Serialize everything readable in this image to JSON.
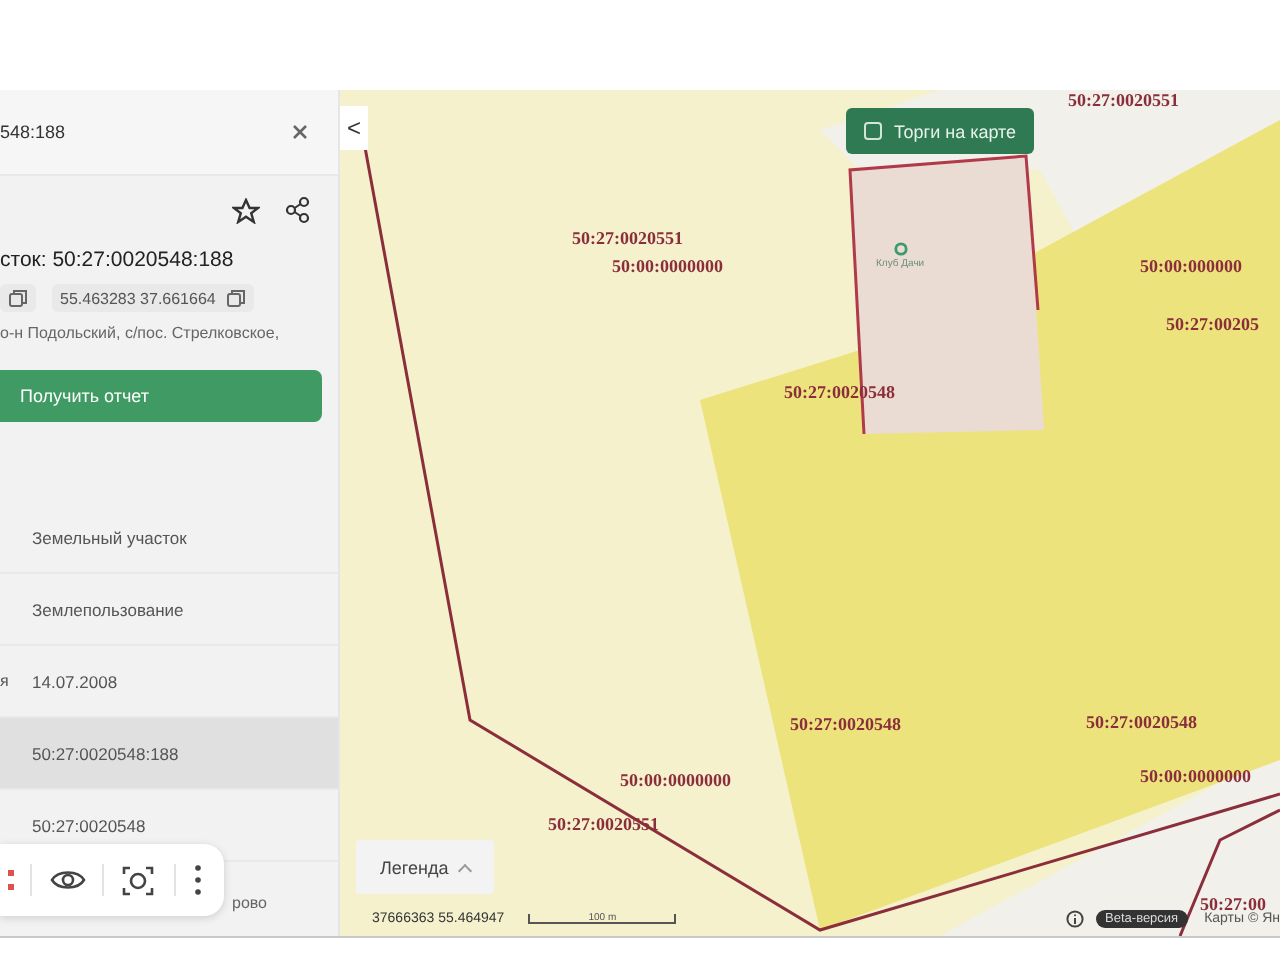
{
  "panel": {
    "title": "548:188",
    "heading": "сток: 50:27:0020548:188",
    "coords": "55.463283 37.661664",
    "address": "о-н Подольский, с/пос. Стрелковское,",
    "report_button": "Получить отчет",
    "rows": [
      {
        "label": null,
        "value": "Земельный участок",
        "selected": false
      },
      {
        "label": null,
        "value": "Землепользование",
        "selected": false
      },
      {
        "label": "я",
        "value": "14.07.2008",
        "selected": false
      },
      {
        "label": null,
        "value": "50:27:0020548:188",
        "selected": true
      },
      {
        "label": null,
        "value": "50:27:0020548",
        "selected": false
      }
    ],
    "behind_text": "рово",
    "toolbar": [
      {
        "kind": "grid"
      },
      {
        "kind": "eye"
      },
      {
        "kind": "camera"
      },
      {
        "kind": "more"
      }
    ]
  },
  "map": {
    "back": "<",
    "auction_toggle": {
      "label": "Торги на карте",
      "checked": false
    },
    "poi": "Клуб Дачи",
    "labels": [
      "50:27:0020551",
      "50:27:0020551",
      "50:00:0000000",
      "50:00:000000",
      "50:27:00205",
      "50:27:0020548",
      "50:27:0020548",
      "50:27:0020548",
      "50:00:0000000",
      "50:27:0020551",
      "50:00:0000000",
      "50:27:00"
    ],
    "legend_button": "Легенда",
    "cursor_coords": "37666363  55.464947",
    "scale": "100 m",
    "beta_badge": "Beta-версия",
    "attribution": "Карты © Ян"
  }
}
